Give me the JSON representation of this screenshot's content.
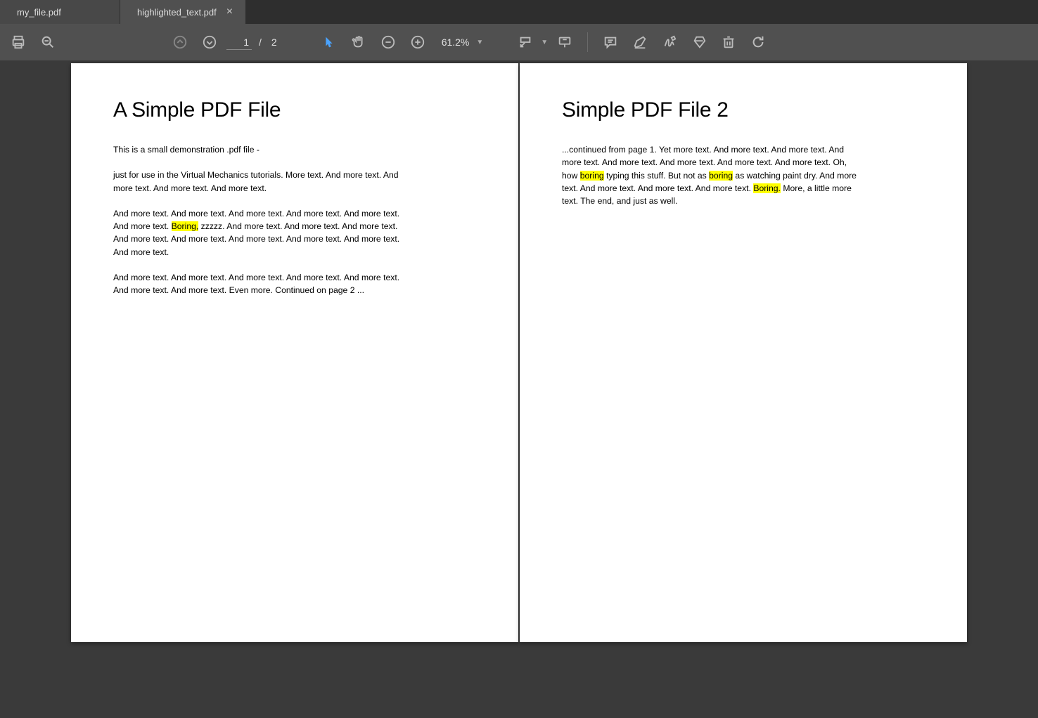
{
  "tabs": [
    {
      "label": "my_file.pdf",
      "active": false
    },
    {
      "label": "highlighted_text.pdf",
      "active": true
    }
  ],
  "toolbar": {
    "currentPage": "1",
    "totalPages": "2",
    "pageSeparator": "/",
    "zoom": "61.2%"
  },
  "pages": [
    {
      "title": "A Simple PDF File",
      "paragraphs": [
        [
          {
            "t": "This is a small demonstration .pdf file -"
          }
        ],
        [
          {
            "t": "just for use in the Virtual Mechanics tutorials. More text. And more text. And more text. And more text. And more text."
          }
        ],
        [
          {
            "t": "And more text. And more text. And more text. And more text. And more text. And more text. "
          },
          {
            "t": "Boring,",
            "hl": true
          },
          {
            "t": " zzzzz. And more text. And more text. And more text. And more text. And more text. And more text. And more text. And more text. And more text."
          }
        ],
        [
          {
            "t": "And more text. And more text. And more text. And more text. And more text. And more text. And more text. Even more. Continued on page 2 ..."
          }
        ]
      ]
    },
    {
      "title": "Simple PDF File 2",
      "paragraphs": [
        [
          {
            "t": "...continued from page 1. Yet more text. And more text. And more text. And more text. And more text. And more text. And more text. And more text. Oh, how "
          },
          {
            "t": "boring",
            "hl": true
          },
          {
            "t": " typing this stuff. But not as "
          },
          {
            "t": "boring",
            "hl": true
          },
          {
            "t": " as watching paint dry. And more text. And more text. And more text. And more text. "
          },
          {
            "t": "Boring.",
            "hl": true
          },
          {
            "t": "  More, a little more text. The end, and just as well."
          }
        ]
      ]
    }
  ]
}
